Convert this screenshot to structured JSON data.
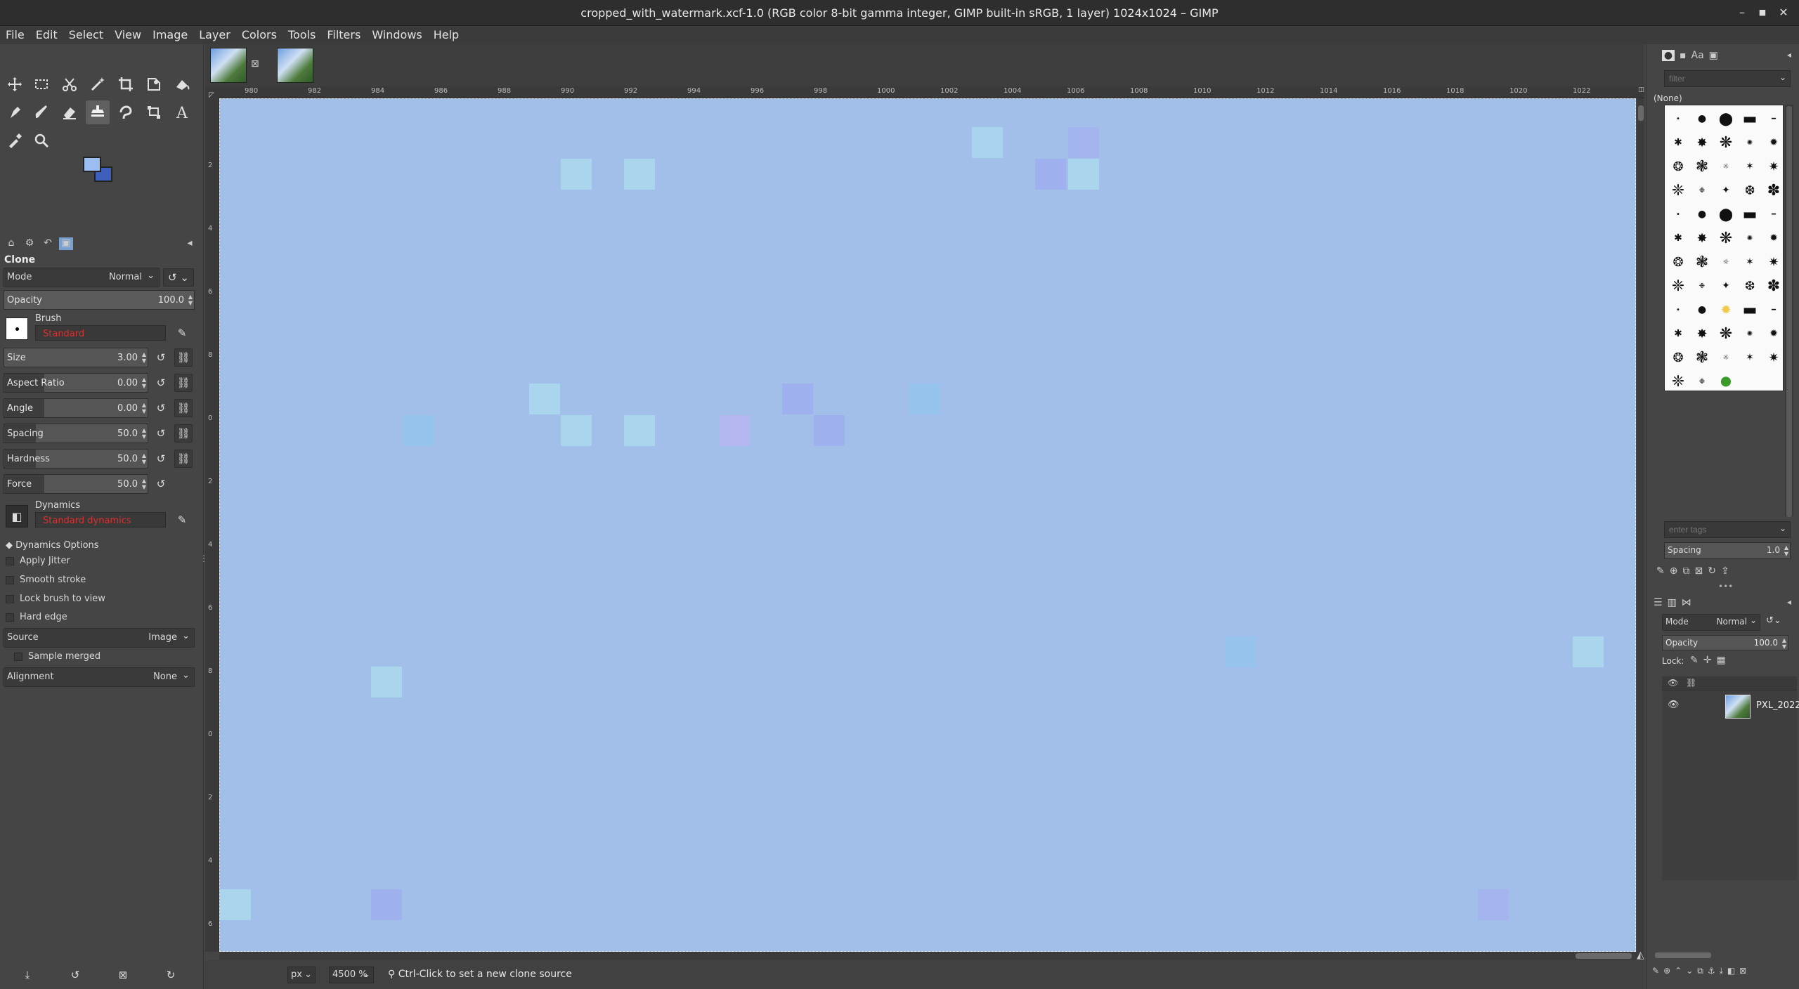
{
  "window": {
    "title": "cropped_with_watermark.xcf-1.0 (RGB color 8-bit gamma integer, GIMP built-in sRGB, 1 layer) 1024x1024 – GIMP"
  },
  "menu": [
    "File",
    "Edit",
    "Select",
    "View",
    "Image",
    "Layer",
    "Colors",
    "Tools",
    "Filters",
    "Windows",
    "Help"
  ],
  "toolbox": {
    "tools": [
      "move-tool",
      "rect-select-tool",
      "scissors-select-tool",
      "fuzzy-select-tool",
      "crop-tool",
      "transform-tool",
      "warp-tool",
      "paint-bucket-tool",
      "paintbrush-tool",
      "eraser-tool",
      "clone-tool",
      "smudge-tool",
      "paths-tool",
      "text-tool",
      "color-picker-tool",
      "zoom-tool"
    ],
    "fg_color": "#9bbdf2",
    "bg_color": "#3e5fbc"
  },
  "tool_options": {
    "title": "Clone",
    "mode_label": "Mode",
    "mode_value": "Normal",
    "opacity_label": "Opacity",
    "opacity_value": "100.0",
    "brush_label": "Brush",
    "brush_value": "Standard",
    "sliders": [
      {
        "label": "Size",
        "value": "3.00",
        "fill": 0.0
      },
      {
        "label": "Aspect Ratio",
        "value": "0.00",
        "fill": 0.28
      },
      {
        "label": "Angle",
        "value": "0.00",
        "fill": 0.28
      },
      {
        "label": "Spacing",
        "value": "50.0",
        "fill": 0.22
      },
      {
        "label": "Hardness",
        "value": "50.0",
        "fill": 0.22
      },
      {
        "label": "Force",
        "value": "50.0",
        "fill": 0.28
      }
    ],
    "dynamics_label": "Dynamics",
    "dynamics_value": "Standard dynamics",
    "dynamics_options": "Dynamics Options",
    "checks": [
      "Apply Jitter",
      "Smooth stroke",
      "Lock brush to view",
      "Hard edge"
    ],
    "source_label": "Source",
    "source_value": "Image",
    "sample_merged": "Sample merged",
    "alignment_label": "Alignment",
    "alignment_value": "None"
  },
  "ruler": {
    "h_ticks": [
      "980",
      "982",
      "984",
      "986",
      "988",
      "990",
      "992",
      "994",
      "996",
      "998",
      "1000",
      "1002",
      "1004",
      "1006",
      "1008",
      "1010",
      "1012",
      "1014",
      "1016",
      "1018",
      "1020",
      "1022"
    ],
    "v_ticks": [
      "2",
      "4",
      "6",
      "8",
      "0",
      "2",
      "4",
      "6",
      "8",
      "0",
      "2",
      "4",
      "6"
    ]
  },
  "statusbar": {
    "unit": "px",
    "zoom": "4500 %",
    "message": "Ctrl-Click to set a new clone source"
  },
  "brushes": {
    "filter_placeholder": "filter",
    "selected": "(None)",
    "tags_placeholder": "enter tags",
    "spacing_label": "Spacing",
    "spacing_value": "1.0"
  },
  "layers": {
    "mode_label": "Mode",
    "mode_value": "Normal",
    "opacity_label": "Opacity",
    "opacity_value": "100.0",
    "lock_label": "Lock:",
    "layer_name": "PXL_2022"
  }
}
